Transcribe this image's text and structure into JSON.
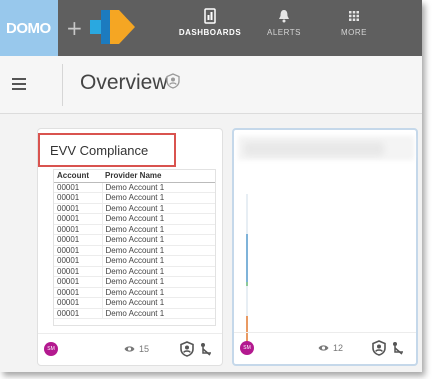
{
  "brand": {
    "logo_text": "DOMO",
    "plus": "+"
  },
  "nav": {
    "dashboards": {
      "label": "DASHBOARDS",
      "icon": "dashboard-icon"
    },
    "alerts": {
      "label": "ALERTS",
      "icon": "bell-icon"
    },
    "more": {
      "label": "MORE",
      "icon": "grid-icon"
    }
  },
  "header": {
    "title": "Overview",
    "owner_icon": "owner-badge-icon"
  },
  "card1": {
    "title": "EVV Compliance",
    "columns": [
      "Account",
      "Provider Name"
    ],
    "rows": [
      [
        "00001",
        "Demo Account 1"
      ],
      [
        "00001",
        "Demo Account 1"
      ],
      [
        "00001",
        "Demo Account 1"
      ],
      [
        "00001",
        "Demo Account 1"
      ],
      [
        "00001",
        "Demo Account 1"
      ],
      [
        "00001",
        "Demo Account 1"
      ],
      [
        "00001",
        "Demo Account 1"
      ],
      [
        "00001",
        "Demo Account 1"
      ],
      [
        "00001",
        "Demo Account 1"
      ],
      [
        "00001",
        "Demo Account 1"
      ],
      [
        "00001",
        "Demo Account 1"
      ],
      [
        "00001",
        "Demo Account 1"
      ],
      [
        "00001",
        "Demo Account 1"
      ]
    ],
    "footer": {
      "avatar": "SM",
      "views": "15"
    }
  },
  "card2": {
    "footer": {
      "avatar": "SM",
      "views": "12"
    }
  },
  "colors": {
    "topbar": "#5f5f5f",
    "domo_blue": "#98c8ec",
    "avatar": "#b3198f",
    "highlight": "#d9534f",
    "card_selected_border": "#c5d8ea"
  }
}
